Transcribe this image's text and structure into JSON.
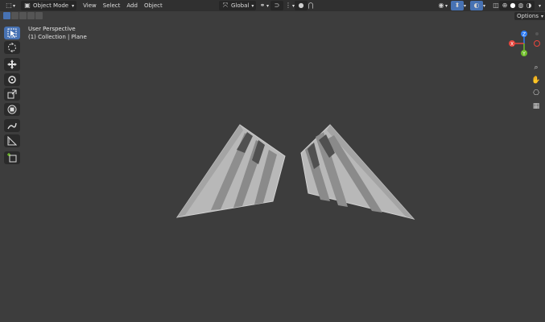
{
  "header": {
    "mode_label": "Object Mode",
    "menus": [
      "View",
      "Select",
      "Add",
      "Object"
    ],
    "transform_orientation": "Global",
    "options_label": "Options"
  },
  "viewport": {
    "view_name": "User Perspective",
    "collection_text": "(1) Collection | Plane"
  },
  "gizmo": {
    "axes": [
      {
        "label": "Z",
        "color": "#2f7df6"
      },
      {
        "label": "X",
        "color": "#e8453c"
      },
      {
        "label": "Y",
        "color": "#6fbf2a"
      }
    ]
  },
  "toolbar": {
    "tools": [
      "select-box-icon",
      "cursor-icon",
      "move-icon",
      "rotate-icon",
      "scale-icon",
      "transform-icon",
      "annotate-icon",
      "measure-icon",
      "add-cube-icon"
    ]
  },
  "colors": {
    "viewport_bg": "#3d3d3d",
    "header_bg": "#303030",
    "accent": "#4772b3",
    "mesh": "#b8b8b8"
  }
}
